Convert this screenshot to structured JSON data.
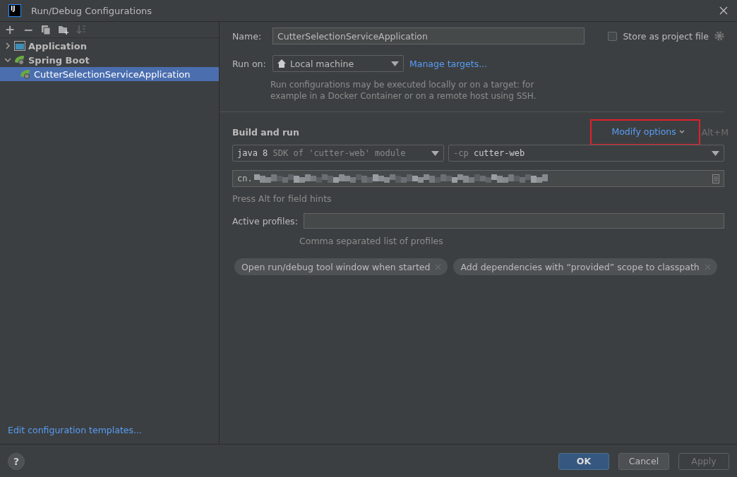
{
  "window": {
    "title": "Run/Debug Configurations",
    "app_icon": "IJ"
  },
  "toolbar": [
    "+",
    "−"
  ],
  "tree": [
    {
      "label": "Application",
      "kind": "application",
      "expanded": false,
      "selected": false
    },
    {
      "label": "Spring Boot",
      "kind": "spring",
      "expanded": true,
      "selected": false,
      "children": [
        {
          "label": "CutterSelectionServiceApplication",
          "kind": "spring",
          "selected": true
        }
      ]
    }
  ],
  "templates_link": "Edit configuration templates...",
  "name": {
    "label": "Name:",
    "value": "CutterSelectionServiceApplication"
  },
  "store_as_project_file": {
    "label": "Store as project file",
    "checked": false
  },
  "run_on": {
    "label": "Run on:",
    "value": "Local machine",
    "link": "Manage targets...",
    "hint": "Run configurations may be executed locally or on a target: for example in a Docker Container or on a remote host using SSH."
  },
  "build_and_run": {
    "title": "Build and run",
    "modify_options": "Modify options",
    "shortcut": "Alt+M",
    "highlighted": true,
    "jdk": {
      "main": "java 8",
      "detail": "SDK of 'cutter-web' module"
    },
    "classpath": {
      "prefix": "-cp",
      "value": "cutter-web"
    },
    "main_class": {
      "value": "cn.",
      "redacted": true
    },
    "field_hint": "Press Alt for field hints"
  },
  "active_profiles": {
    "label": "Active profiles:",
    "hint": "Comma separated list of profiles"
  },
  "options": [
    {
      "label": "Open run/debug tool window when started"
    },
    {
      "label": "Add dependencies with “provided” scope to classpath"
    }
  ],
  "buttons": [
    {
      "label": "OK",
      "kind": "primary",
      "disabled": false
    },
    {
      "label": "Cancel",
      "kind": "normal",
      "disabled": false
    },
    {
      "label": "Apply",
      "kind": "normal",
      "disabled": true
    }
  ],
  "help": "?"
}
